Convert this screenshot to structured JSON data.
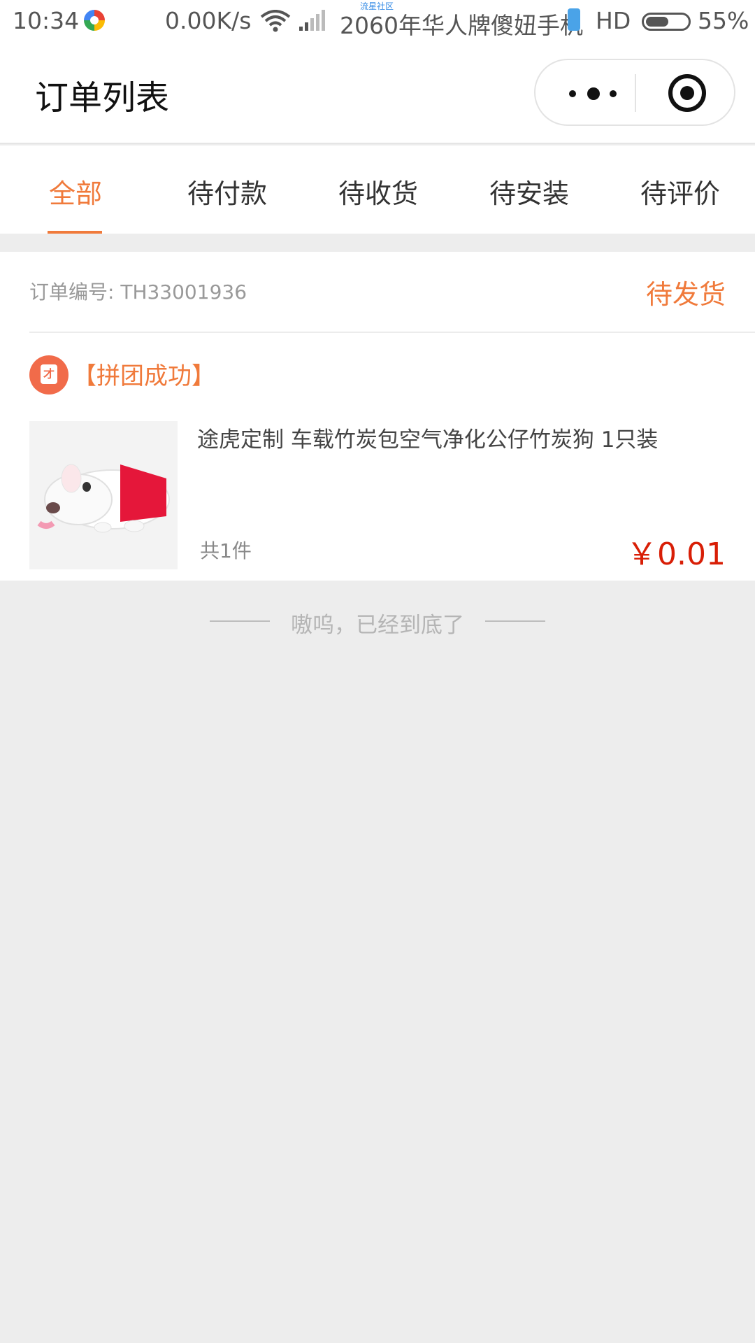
{
  "status_bar": {
    "time": "10:34",
    "network_speed": "0.00K/s",
    "carrier": "2060年华人牌傻妞手机",
    "watermark": "流星社区",
    "hd": "HD",
    "battery_percent": "55%",
    "battery_level": 0.55
  },
  "header": {
    "title": "订单列表"
  },
  "tabs": [
    {
      "label": "全部",
      "active": true
    },
    {
      "label": "待付款",
      "active": false
    },
    {
      "label": "待收货",
      "active": false
    },
    {
      "label": "待安装",
      "active": false
    },
    {
      "label": "待评价",
      "active": false
    }
  ],
  "order": {
    "number_label": "订单编号: TH33001936",
    "status": "待发货",
    "group_badge": "【拼团成功】",
    "group_icon_text": "才",
    "product": {
      "title": "途虎定制 车载竹炭包空气净化公仔竹炭狗 1只装",
      "count": "共1件",
      "price": "￥0.01"
    }
  },
  "footer": {
    "end_text": "嗷呜，已经到底了"
  },
  "colors": {
    "accent": "#f07a3b",
    "price": "#d81e06",
    "background": "#ededed"
  }
}
